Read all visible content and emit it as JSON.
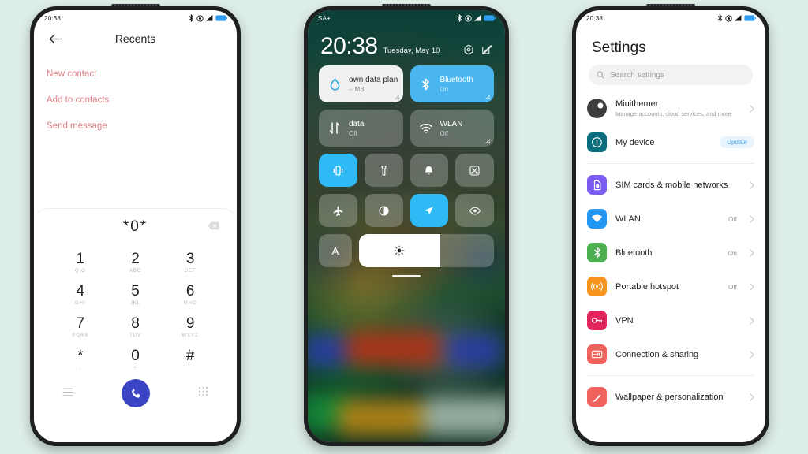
{
  "background_color": "#ddeee6",
  "phone1": {
    "name": "dialer-recents",
    "statusbar": {
      "time": "20:38",
      "icons": [
        "bluetooth-icon",
        "dnd-icon",
        "signal-icon",
        "battery-icon"
      ]
    },
    "header": {
      "back_icon": "back-arrow-icon",
      "title": "Recents"
    },
    "actions": [
      {
        "label": "New contact"
      },
      {
        "label": "Add to contacts"
      },
      {
        "label": "Send message"
      }
    ],
    "action_color": "#e08288",
    "dialpad": {
      "number": "*0*",
      "delete_icon": "backspace-icon",
      "keys": [
        {
          "digit": "1",
          "letters": "Q.O"
        },
        {
          "digit": "2",
          "letters": "ABC"
        },
        {
          "digit": "3",
          "letters": "DEF"
        },
        {
          "digit": "4",
          "letters": "GHI"
        },
        {
          "digit": "5",
          "letters": "JKL"
        },
        {
          "digit": "6",
          "letters": "MNO"
        },
        {
          "digit": "7",
          "letters": "PQRS"
        },
        {
          "digit": "8",
          "letters": "TUV"
        },
        {
          "digit": "9",
          "letters": "WXYZ"
        },
        {
          "digit": "*",
          "letters": ","
        },
        {
          "digit": "0",
          "letters": "+"
        },
        {
          "digit": "#",
          "letters": ""
        }
      ],
      "bottom": {
        "menu_icon": "menu-lines-icon",
        "call_icon": "call-handset-icon",
        "call_button_color": "#3b44c4",
        "keypad_icon": "dialpad-grid-icon"
      }
    }
  },
  "phone2": {
    "name": "control-center",
    "statusbar": {
      "carrier": "SA+",
      "icons": [
        "bluetooth-icon",
        "dnd-icon",
        "signal-icon",
        "battery-icon"
      ]
    },
    "clock": {
      "time": "20:38",
      "date": "Tuesday, May 10"
    },
    "header_icons": [
      "settings-hex-icon",
      "edit-icon"
    ],
    "big_tiles": [
      {
        "name": "data-usage-tile",
        "icon": "data-drop-icon",
        "title": "own data plan",
        "subtitle": "-- MB",
        "state": "white",
        "has_corner": true
      },
      {
        "name": "bluetooth-tile",
        "icon": "bluetooth-icon",
        "title": "Bluetooth",
        "subtitle": "On",
        "state": "on",
        "has_corner": true
      },
      {
        "name": "mobile-data-tile",
        "icon": "data-arrows-icon",
        "title": "data",
        "subtitle": "Off",
        "state": "glass",
        "has_corner": false
      },
      {
        "name": "wlan-tile",
        "icon": "wifi-icon",
        "title": "WLAN",
        "subtitle": "Off",
        "state": "glass",
        "has_corner": true
      }
    ],
    "toggles": [
      {
        "name": "vibrate-toggle",
        "icon": "vibrate-icon",
        "on": true
      },
      {
        "name": "flashlight-toggle",
        "icon": "flashlight-icon",
        "on": false
      },
      {
        "name": "ringer-toggle",
        "icon": "bell-icon",
        "on": false
      },
      {
        "name": "screenshot-toggle",
        "icon": "screenshot-scissors-icon",
        "on": false
      },
      {
        "name": "airplane-toggle",
        "icon": "airplane-icon",
        "on": false
      },
      {
        "name": "dark-mode-toggle",
        "icon": "contrast-circle-icon",
        "on": false
      },
      {
        "name": "location-toggle",
        "icon": "location-arrow-icon",
        "on": true
      },
      {
        "name": "reading-mode-toggle",
        "icon": "eye-icon",
        "on": false
      }
    ],
    "brightness": {
      "auto_label": "A",
      "icon": "sun-brightness-icon",
      "percent": 60
    },
    "handle": "drag-handle",
    "accent_on_color": "#2fb9f5"
  },
  "phone3": {
    "name": "settings-app",
    "statusbar": {
      "time": "20:38",
      "icons": [
        "bluetooth-icon",
        "dnd-icon",
        "signal-icon",
        "battery-icon"
      ]
    },
    "title": "Settings",
    "search": {
      "icon": "search-icon",
      "placeholder": "Search settings"
    },
    "account": {
      "avatar": "user-avatar",
      "name": "Miuithemer",
      "subtitle": "Manage accounts, cloud services, and more"
    },
    "my_device": {
      "icon": "info-circle-icon",
      "label": "My device",
      "badge": "Update",
      "color": "#0b6e7f"
    },
    "items": [
      {
        "name": "sim-cards",
        "label": "SIM cards & mobile networks",
        "value": "",
        "icon": "sim-card-icon",
        "color": "#7c5cf0"
      },
      {
        "name": "wlan",
        "label": "WLAN",
        "value": "Off",
        "icon": "wifi-icon",
        "color": "#2196f3"
      },
      {
        "name": "bluetooth",
        "label": "Bluetooth",
        "value": "On",
        "icon": "bluetooth-icon",
        "color": "#4caf50"
      },
      {
        "name": "portable-hotspot",
        "label": "Portable hotspot",
        "value": "Off",
        "icon": "hotspot-icon",
        "color": "#f7941e"
      },
      {
        "name": "vpn",
        "label": "VPN",
        "value": "",
        "icon": "vpn-key-icon",
        "color": "#e0265c"
      },
      {
        "name": "connection-sharing",
        "label": "Connection & sharing",
        "value": "",
        "icon": "connection-icon",
        "color": "#f0625e"
      }
    ],
    "last_item": {
      "name": "wallpaper-personalization",
      "label": "Wallpaper & personalization",
      "icon": "brush-icon",
      "color": "#f0625e"
    }
  }
}
